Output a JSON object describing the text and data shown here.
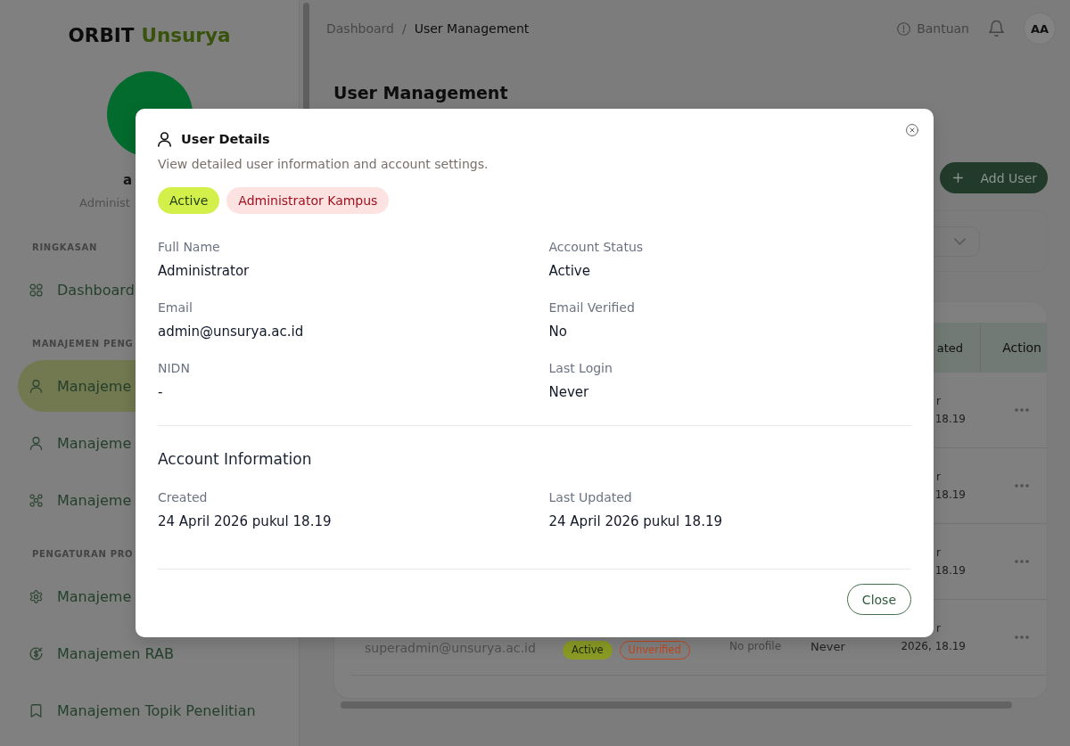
{
  "sidebar": {
    "logo": {
      "name": "ORBIT",
      "suffix": "Unsurya"
    },
    "user": {
      "name": "a",
      "role": "Administ"
    },
    "sections": [
      {
        "heading": "RINGKASAN",
        "items": [
          {
            "label": "Dashboard",
            "selected": false
          }
        ]
      },
      {
        "heading": "MANAJEMEN PENG",
        "items": [
          {
            "label": "Manajeme",
            "selected": true
          },
          {
            "label": "Manajeme",
            "selected": false
          },
          {
            "label": "Manajeme",
            "selected": false
          }
        ]
      },
      {
        "heading": "PENGATURAN PRO",
        "items": [
          {
            "label": "Manajeme",
            "selected": false
          },
          {
            "label": "Manajemen RAB",
            "selected": false
          },
          {
            "label": "Manajemen Topik Penelitian",
            "selected": false
          }
        ]
      }
    ]
  },
  "header": {
    "breadcrumb": {
      "separator": "/",
      "items": [
        {
          "label": "Dashboard",
          "current": false
        },
        {
          "label": "User Management",
          "current": true
        }
      ]
    },
    "help": "Bantuan",
    "avatar": "AA"
  },
  "page": {
    "title": "User Management",
    "add_button": "Add User"
  },
  "table": {
    "columns": [
      "ated",
      "Action"
    ],
    "rows": [
      {
        "column_5": [
          "r",
          "18.19"
        ]
      },
      {
        "column_5": [
          "r",
          "18.19"
        ]
      },
      {
        "column_5": [
          "r",
          "18.19"
        ]
      },
      {
        "column_1": "superadmin@unsurya.ac.id",
        "column_2": [
          {
            "label": "Active",
            "kind": "status"
          },
          {
            "label": "Unverified",
            "kind": "verification"
          }
        ],
        "column_3": "No profile",
        "column_4": "Never",
        "column_5": [
          "r",
          "2026, 18.19"
        ]
      }
    ]
  },
  "dialog": {
    "title": "User Details",
    "subtitle": "View detailed user information and account settings.",
    "badges": [
      {
        "label": "Active",
        "kind": "status"
      },
      {
        "label": "Administrator Kampus",
        "kind": "role"
      }
    ],
    "fields": [
      {
        "label": "Full Name",
        "value": "Administrator"
      },
      {
        "label": "Account Status",
        "value": "Active"
      },
      {
        "label": "Email",
        "value": "admin@unsurya.ac.id"
      },
      {
        "label": "Email Verified",
        "value": "No"
      },
      {
        "label": "NIDN",
        "value": "-"
      },
      {
        "label": "Last Login",
        "value": "Never"
      }
    ],
    "section_title": "Account Information",
    "account_fields": [
      {
        "label": "Created",
        "value": "24 April 2026 pukul 18.19"
      },
      {
        "label": "Last Updated",
        "value": "24 April 2026 pukul 18.19"
      }
    ],
    "close_button": "Close"
  }
}
